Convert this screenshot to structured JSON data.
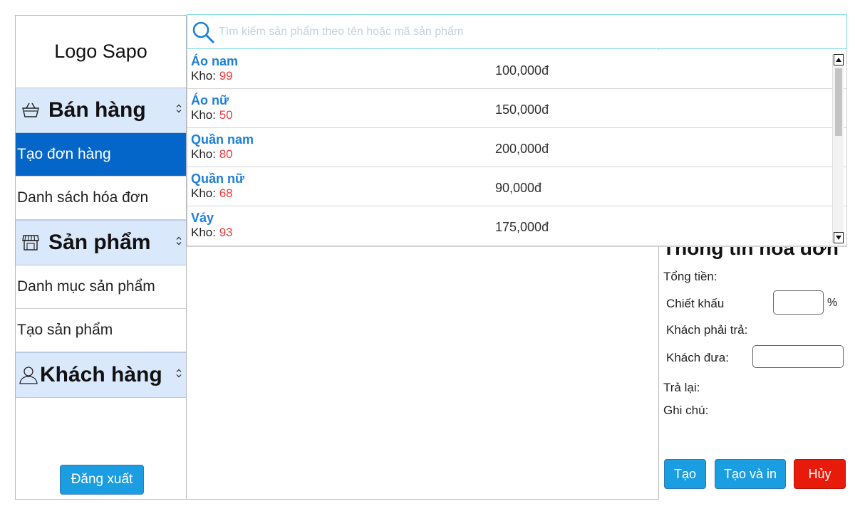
{
  "sidebar": {
    "logo": "Logo Sapo",
    "groups": [
      {
        "label": "Bán hàng",
        "icon": "basket-icon"
      },
      {
        "label": "Sản phẩm",
        "icon": "store-icon"
      },
      {
        "label": "Khách hàng",
        "icon": "user-icon"
      }
    ],
    "items": {
      "create_order": "Tạo đơn hàng",
      "invoice_list": "Danh sách hóa đơn",
      "product_catalog": "Danh mục sản phẩm",
      "create_product": "Tạo sản phẩm"
    },
    "logout": "Đăng xuất"
  },
  "search": {
    "placeholder": "Tìm kiếm sản phẩm theo tên hoặc mã sản phẩm",
    "value": ""
  },
  "products": [
    {
      "name": "Áo nam",
      "stock_label": "Kho:",
      "stock": "99",
      "price": "100,000đ"
    },
    {
      "name": "Áo nữ",
      "stock_label": "Kho:",
      "stock": "50",
      "price": "150,000đ"
    },
    {
      "name": "Quần nam",
      "stock_label": "Kho:",
      "stock": "80",
      "price": "200,000đ"
    },
    {
      "name": "Quần nữ",
      "stock_label": "Kho:",
      "stock": "68",
      "price": "90,000đ"
    },
    {
      "name": "Váy",
      "stock_label": "Kho:",
      "stock": "93",
      "price": "175,000đ"
    }
  ],
  "invoice": {
    "title": "Thông tin hóa đơn",
    "total_label": "Tổng tiền:",
    "discount_label": "Chiết khấu",
    "discount_unit": "%",
    "discount_value": "",
    "payable_label": "Khách phải trả:",
    "paid_label": "Khách đưa:",
    "paid_value": "",
    "change_label": "Trả lại:",
    "note_label": "Ghi chú:"
  },
  "actions": {
    "create": "Tạo",
    "create_print": "Tạo và in",
    "cancel": "Hủy"
  },
  "colors": {
    "accent": "#1b9de2",
    "active_menu": "#0466c8",
    "group_bg": "#dae8fb",
    "product_name": "#1c7fd8",
    "stock_number": "#ee3b3b",
    "cancel": "#e81a0a"
  }
}
